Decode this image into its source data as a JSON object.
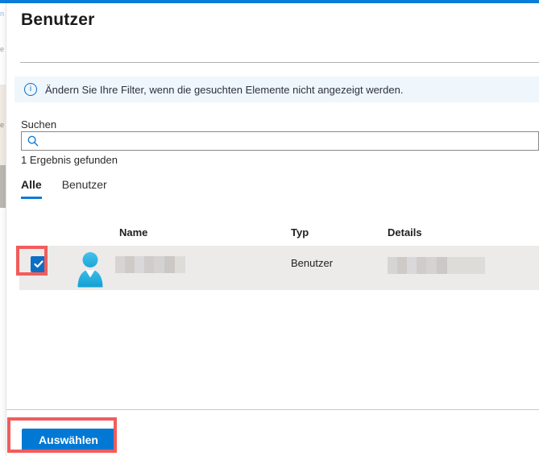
{
  "background_page": {
    "fragments": [
      "n",
      "e",
      "e"
    ]
  },
  "panel": {
    "title": "Benutzer",
    "banner": {
      "icon": "info-icon",
      "text": "Ändern Sie Ihre Filter, wenn die gesuchten Elemente nicht angezeigt werden."
    },
    "search": {
      "label": "Suchen",
      "value": "",
      "placeholder": "",
      "icon": "search-icon",
      "results_text": "1 Ergebnis gefunden"
    },
    "tabs": [
      {
        "label": "Alle",
        "active": true
      },
      {
        "label": "Benutzer",
        "active": false
      }
    ],
    "table": {
      "columns": [
        "Name",
        "Typ",
        "Details"
      ],
      "row": {
        "selected": true,
        "name_redacted": true,
        "type": "Benutzer",
        "details_redacted": true,
        "avatar": "user-avatar-icon"
      }
    },
    "footer": {
      "select_label": "Auswählen"
    }
  },
  "annotations": {
    "checkbox_highlight": true,
    "select_button_highlight": true,
    "color": "#f25c5c"
  },
  "colors": {
    "accent_blue": "#0078d4",
    "topbar_blue": "#0b7cd8",
    "banner_bg": "#eff6fc",
    "row_selected_bg": "#edebe9",
    "checkbox_blue": "#0b6fc4",
    "avatar_cyan": "#2fb4e1",
    "annotation_red": "#f25c5c"
  }
}
